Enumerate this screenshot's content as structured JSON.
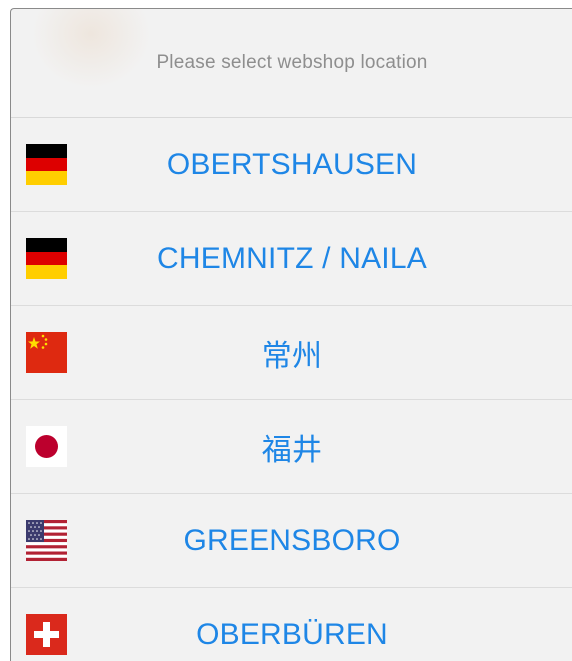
{
  "header": {
    "title": "Please select webshop location"
  },
  "locations": [
    {
      "label": "OBERTSHAUSEN",
      "flag": "germany-flag-icon"
    },
    {
      "label": "CHEMNITZ / NAILA",
      "flag": "germany-flag-icon"
    },
    {
      "label": "常州",
      "flag": "china-flag-icon"
    },
    {
      "label": "福井",
      "flag": "japan-flag-icon"
    },
    {
      "label": "GREENSBORO",
      "flag": "usa-flag-icon"
    },
    {
      "label": "OBERBÜREN",
      "flag": "switzerland-flag-icon"
    }
  ],
  "colors": {
    "link": "#1e86e6",
    "header_text": "#8e8e8e",
    "background": "#f2f2f2"
  }
}
